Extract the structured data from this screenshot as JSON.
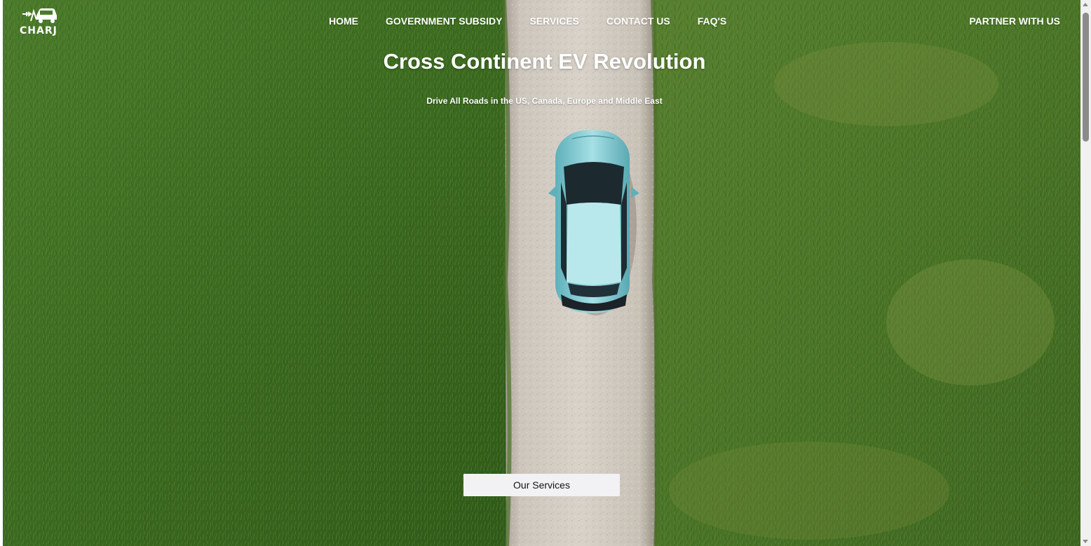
{
  "brand": {
    "logo_text": "CHARJ",
    "logo_icon": "ev-charging-car-icon"
  },
  "nav": {
    "items": [
      {
        "label": "HOME"
      },
      {
        "label": "GOVERNMENT SUBSIDY"
      },
      {
        "label": "SERVICES"
      },
      {
        "label": "CONTACT US"
      },
      {
        "label": "FAQ'S"
      }
    ],
    "partner_label": "PARTNER WITH US"
  },
  "hero": {
    "title": "Cross Continent EV Revolution",
    "subtitle": "Drive All Roads in the US, Canada, Europe and Middle East",
    "cta_label": "Our Services",
    "background": "aerial-road-grass-car-photo"
  },
  "colors": {
    "grass_dark": "#3d6a22",
    "grass_light": "#5c8a33",
    "road": "#c9c2b8",
    "car": "#8fd0d8",
    "button_bg": "#f2f2f4",
    "text_light": "#ffffff"
  }
}
